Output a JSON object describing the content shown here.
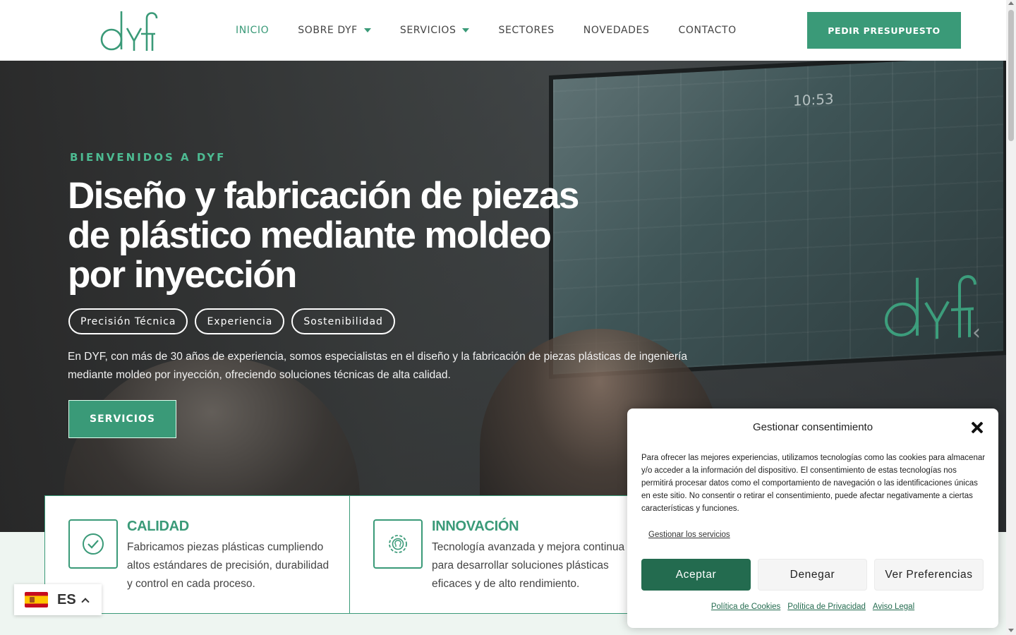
{
  "brand": {
    "logo_text": "dyf",
    "accent_color": "#3a9a78",
    "dark_accent": "#236b4f"
  },
  "nav": {
    "items": [
      {
        "label": "INICIO",
        "active": true,
        "has_dropdown": false
      },
      {
        "label": "SOBRE DYF",
        "active": false,
        "has_dropdown": true
      },
      {
        "label": "SERVICIOS",
        "active": false,
        "has_dropdown": true
      },
      {
        "label": "SECTORES",
        "active": false,
        "has_dropdown": false
      },
      {
        "label": "NOVEDADES",
        "active": false,
        "has_dropdown": false
      },
      {
        "label": "CONTACTO",
        "active": false,
        "has_dropdown": false
      }
    ],
    "cta_label": "PEDIR PRESUPUESTO"
  },
  "hero": {
    "kicker": "BIENVENIDOS A DYF",
    "headline": "Diseño y fabricación de piezas de plástico mediante moldeo por inyección",
    "pills": [
      "Precisión Técnica",
      "Experiencia",
      "Sostenibilidad"
    ],
    "description": "En DYF, con más de 30 años de experiencia, somos especialistas en el diseño y la fabricación de piezas plásticas de ingeniería mediante moldeo por inyección, ofreciendo soluciones técnicas de alta calidad.",
    "button_label": "SERVICIOS",
    "screen_clock": "10:53",
    "slider_arrow": "‹"
  },
  "features": [
    {
      "title": "CALIDAD",
      "text": "Fabricamos piezas plásticas cumpliendo altos estándares de precisión, durabilidad y control en cada proceso.",
      "icon": "check-circle-icon"
    },
    {
      "title": "INNOVACIÓN",
      "text": "Tecnología avanzada y mejora continua para desarrollar soluciones plásticas eficaces y de alto rendimiento.",
      "icon": "gear-bulb-icon"
    }
  ],
  "language": {
    "code": "ES",
    "flag": "spain-flag-icon"
  },
  "consent": {
    "title": "Gestionar consentimiento",
    "text": "Para ofrecer las mejores experiencias, utilizamos tecnologías como las cookies para almacenar y/o acceder a la información del dispositivo. El consentimiento de estas tecnologías nos permitirá procesar datos como el comportamiento de navegación o las identificaciones únicas en este sitio. No consentir o retirar el consentimiento, puede afectar negativamente a ciertas características y funciones.",
    "manage_link": "Gestionar los servicios",
    "accept": "Aceptar",
    "deny": "Denegar",
    "preferences": "Ver Preferencias",
    "footer_links": [
      "Política de Cookies",
      "Política de Privacidad",
      "Aviso Legal"
    ]
  }
}
